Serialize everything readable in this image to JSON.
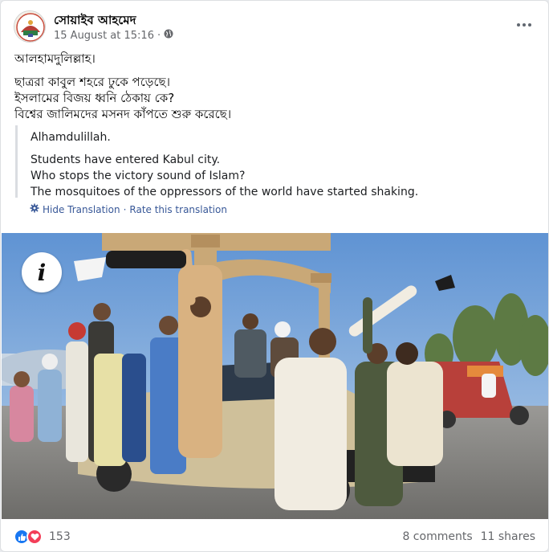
{
  "post": {
    "author": "সোয়াইব আহমেদ",
    "timestamp": "15 August at 15:16",
    "separator": "·",
    "privacy_icon": "globe-icon",
    "more_icon": "more-horizontal-icon"
  },
  "content": {
    "line1": "আলহামদুলিল্লাহ।",
    "line2": "ছাত্ররা কাবুল শহরে ঢুকে পড়েছে।",
    "line3": "ইসলামের বিজয় ধ্বনি ঠেকায় কে?",
    "line4": "বিশ্বের জালিমদের মসনদ কাঁপতে শুরু করেছে।"
  },
  "translation": {
    "line1": "Alhamdulillah.",
    "line2": "Students have entered Kabul city.",
    "line3": "Who stops the victory sound of Islam?",
    "line4": "The mosquitoes of the oppressors of the world have started shaking.",
    "hide_label": "Hide Translation",
    "dot": "·",
    "rate_label": "Rate this translation",
    "icon": "gear-icon"
  },
  "photo": {
    "info_label": "i",
    "info_icon": "info-icon"
  },
  "footer": {
    "reaction_count": "153",
    "comments": "8 comments",
    "shares": "11 shares",
    "reaction_icons": [
      "like-icon",
      "love-icon"
    ]
  },
  "colors": {
    "link": "#385898",
    "like": "#1877f2",
    "love": "#f33e58",
    "secondary_text": "#65676b"
  }
}
